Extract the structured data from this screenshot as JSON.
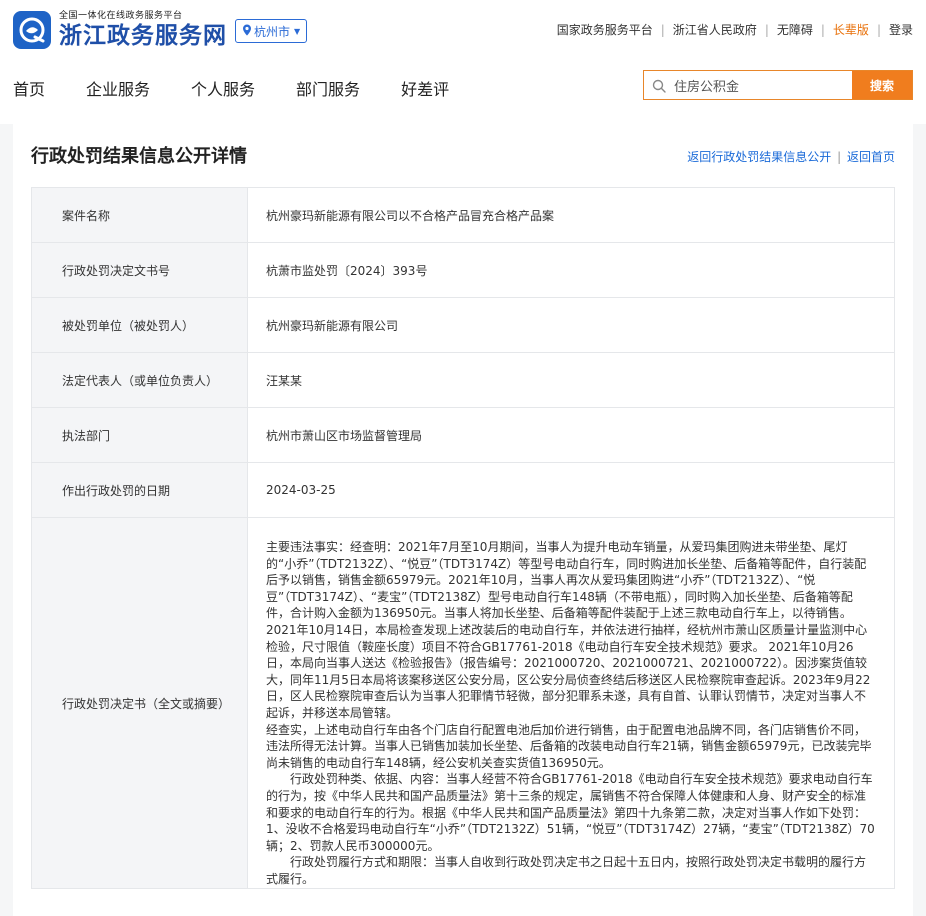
{
  "header": {
    "logo_sub": "全国一体化在线政务服务平台",
    "logo_main": "浙江政务服务网",
    "city": "杭州市",
    "top_links": [
      "国家政务服务平台",
      "浙江省人民政府",
      "无障碍",
      "长辈版",
      "登录"
    ],
    "nav": [
      "首页",
      "企业服务",
      "个人服务",
      "部门服务",
      "好差评"
    ],
    "search": {
      "value": "住房公积金",
      "button": "搜索"
    },
    "colors": {
      "brand_blue": "#1f4fa8",
      "accent_orange": "#f07d1e",
      "link_blue": "#1a6ad8"
    }
  },
  "page": {
    "title": "行政处罚结果信息公开详情",
    "links": [
      "返回行政处罚结果信息公开",
      "返回首页"
    ]
  },
  "table": {
    "rows": [
      {
        "label": "案件名称",
        "value": "杭州豪玛新能源有限公司以不合格产品冒充合格产品案"
      },
      {
        "label": "行政处罚决定文书号",
        "value": "杭萧市监处罚〔2024〕393号"
      },
      {
        "label": "被处罚单位（被处罚人）",
        "value": "杭州豪玛新能源有限公司"
      },
      {
        "label": "法定代表人（或单位负责人）",
        "value": "汪某某"
      },
      {
        "label": "执法部门",
        "value": "杭州市萧山区市场监督管理局"
      },
      {
        "label": "作出行政处罚的日期",
        "value": "2024-03-25"
      }
    ],
    "decision_label": "行政处罚决定书（全文或摘要）",
    "decision_paragraphs": [
      "主要违法事实：经查明：2021年7月至10月期间，当事人为提升电动车销量，从爱玛集团购进未带坐垫、尾灯的“小乔”（TDT2132Z）、“悦豆”（TDT3174Z）等型号电动自行车，同时购进加长坐垫、后备箱等配件，自行装配后予以销售，销售金额65979元。2021年10月，当事人再次从爱玛集团购进“小乔”（TDT2132Z）、“悦豆”（TDT3174Z）、“麦宝”（TDT2138Z）型号电动自行车148辆（不带电瓶），同时购入加长坐垫、后备箱等配件，合计购入金额为136950元。当事人将加长坐垫、后备箱等配件装配于上述三款电动自行车上，以待销售。2021年10月14日，本局检查发现上述改装后的电动自行车，并依法进行抽样，经杭州市萧山区质量计量监测中心检验，尺寸限值（鞍座长度）项目不符合GB17761-2018《电动自行车安全技术规范》要求。 2021年10月26日，本局向当事人送达《检验报告》（报告编号：2021000720、2021000721、2021000722）。因涉案货值较大，同年11月5日本局将该案移送区公安分局，区公安分局侦查终结后移送区人民检察院审查起诉。2023年9月22日，区人民检察院审查后认为当事人犯罪情节轻微，部分犯罪系未遂，具有自首、认罪认罚情节，决定对当事人不起诉，并移送本局管辖。",
      "经查实，上述电动自行车由各个门店自行配置电池后加价进行销售，由于配置电池品牌不同，各门店销售价不同，违法所得无法计算。当事人已销售加装加长坐垫、后备箱的改装电动自行车21辆，销售金额65979元，已改装完毕尚未销售的电动自行车148辆，经公安机关查实货值136950元。",
      "　　行政处罚种类、依据、内容：当事人经营不符合GB17761-2018《电动自行车安全技术规范》要求电动自行车的行为，按《中华人民共和国产品质量法》第十三条的规定，属销售不符合保障人体健康和人身、财产安全的标准和要求的电动自行车的行为。根据《中华人民共和国产品质量法》第四十九条第二款，决定对当事人作如下处罚：1、没收不合格爱玛电动自行车“小乔”（TDT2132Z）51辆，“悦豆”（TDT3174Z）27辆，“麦宝”（TDT2138Z）70辆；2、罚款人民币300000元。",
      "　　行政处罚履行方式和期限：当事人自收到行政处罚决定书之日起十五日内，按照行政处罚决定书载明的履行方式履行。"
    ]
  }
}
